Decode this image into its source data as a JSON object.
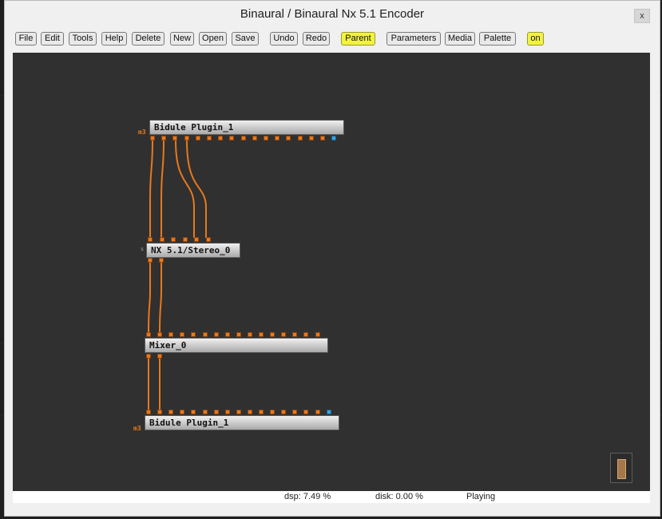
{
  "window": {
    "title": "Binaural / Binaural Nx 5.1 Encoder",
    "close_label": "x"
  },
  "toolbar": [
    {
      "id": "file",
      "label": "File",
      "highlight": false
    },
    {
      "id": "edit",
      "label": "Edit",
      "highlight": false
    },
    {
      "id": "tools",
      "label": "Tools",
      "highlight": false
    },
    {
      "id": "help",
      "label": "Help",
      "highlight": false
    },
    {
      "id": "delete",
      "label": "Delete",
      "highlight": false
    },
    {
      "id": "new",
      "label": "New",
      "highlight": false
    },
    {
      "id": "open",
      "label": "Open",
      "highlight": false
    },
    {
      "id": "save",
      "label": "Save",
      "highlight": false
    },
    {
      "id": "undo",
      "label": "Undo",
      "highlight": false
    },
    {
      "id": "redo",
      "label": "Redo",
      "highlight": false
    },
    {
      "id": "parent",
      "label": "Parent",
      "highlight": true
    },
    {
      "id": "parameters",
      "label": "Parameters",
      "highlight": false
    },
    {
      "id": "media",
      "label": "Media",
      "highlight": false
    },
    {
      "id": "palette",
      "label": "Palette",
      "highlight": false
    },
    {
      "id": "on",
      "label": "on",
      "highlight": true
    }
  ],
  "modules": {
    "plugin_top": {
      "name": "Bidule Plugin_1",
      "tag": "m3"
    },
    "nx": {
      "name": "NX 5.1/Stereo_0",
      "tag": "s"
    },
    "mixer": {
      "name": "Mixer_0"
    },
    "plugin_bottom": {
      "name": "Bidule Plugin_1",
      "tag": "m3"
    }
  },
  "status": {
    "dsp": "dsp:  7.49 %",
    "disk": "disk:  0.00 %",
    "state": "Playing"
  },
  "colors": {
    "wire": "#e8791d",
    "pin_audio": "#e8791d",
    "pin_midi": "#3aa3de",
    "highlight": "#f3f33c",
    "canvas": "#303030"
  }
}
